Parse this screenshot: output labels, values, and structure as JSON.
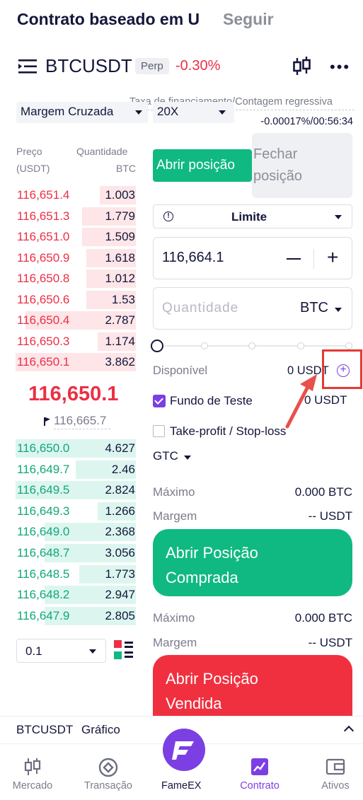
{
  "top_tabs": {
    "active": "Contrato baseado em U",
    "inactive": "Seguir"
  },
  "header": {
    "symbol": "BTCUSDT",
    "badge": "Perp",
    "change": "-0.30%"
  },
  "funding": {
    "label": "Taxa de financiamento/Contagem regressiva",
    "value": "-0.00017%/00:56:34"
  },
  "margin_mode": "Margem Cruzada",
  "leverage": "20X",
  "order_book": {
    "price_header": "Preço",
    "price_unit": "(USDT)",
    "qty_header": "Quantidade",
    "qty_unit": "BTC",
    "asks": [
      {
        "price": "116,651.4",
        "qty": "1.003",
        "depth": 0.3
      },
      {
        "price": "116,651.3",
        "qty": "1.779",
        "depth": 0.45
      },
      {
        "price": "116,651.0",
        "qty": "1.509",
        "depth": 0.45
      },
      {
        "price": "116,650.9",
        "qty": "1.618",
        "depth": 0.41
      },
      {
        "price": "116,650.8",
        "qty": "1.012",
        "depth": 0.41
      },
      {
        "price": "116,650.6",
        "qty": "1.53",
        "depth": 0.41
      },
      {
        "price": "116,650.4",
        "qty": "2.787",
        "depth": 0.92
      },
      {
        "price": "116,650.3",
        "qty": "1.174",
        "depth": 0.32
      },
      {
        "price": "116,650.1",
        "qty": "3.862",
        "depth": 1.0
      }
    ],
    "last_price": "116,650.1",
    "mark_price": "116,665.7",
    "bids": [
      {
        "price": "116,650.0",
        "qty": "4.627",
        "depth": 1.0
      },
      {
        "price": "116,649.7",
        "qty": "2.46",
        "depth": 0.5
      },
      {
        "price": "116,649.5",
        "qty": "2.824",
        "depth": 1.0
      },
      {
        "price": "116,649.3",
        "qty": "1.266",
        "depth": 0.32
      },
      {
        "price": "116,649.0",
        "qty": "2.368",
        "depth": 0.76
      },
      {
        "price": "116,648.7",
        "qty": "3.056",
        "depth": 0.76
      },
      {
        "price": "116,648.5",
        "qty": "1.773",
        "depth": 0.47
      },
      {
        "price": "116,648.2",
        "qty": "2.947",
        "depth": 0.76
      },
      {
        "price": "116,647.9",
        "qty": "2.805",
        "depth": 0.76
      }
    ],
    "depth_precision": "0.1"
  },
  "trade": {
    "open_label": "Abrir posição",
    "close_label_1": "Fechar",
    "close_label_2": "posição",
    "order_type": "Limite",
    "price_value": "116,664.1",
    "qty_placeholder": "Quantidade",
    "qty_unit": "BTC",
    "available_label": "Disponível",
    "available_value": "0 USDT",
    "test_fund_label": "Fundo de Teste",
    "test_fund_value": "0 USDT",
    "tp_sl_label": "Take-profit / Stop-loss",
    "tif": "GTC",
    "long": {
      "max_label": "Máximo",
      "max_value": "0.000 BTC",
      "margin_label": "Margem",
      "margin_value": "-- USDT",
      "button": "Abrir Posição Comprada"
    },
    "short": {
      "max_label": "Máximo",
      "max_value": "0.000 BTC",
      "margin_label": "Margem",
      "margin_value": "-- USDT",
      "button": "Abrir Posição Vendida"
    }
  },
  "chart_bar": {
    "symbol": "BTCUSDT",
    "label": "Gráfico"
  },
  "nav": {
    "market": "Mercado",
    "transaction": "Transação",
    "center": "FameEX",
    "contract": "Contrato",
    "assets": "Ativos"
  },
  "colors": {
    "up": "#10b981",
    "down": "#ec2f44",
    "accent": "#7b3fe4"
  }
}
